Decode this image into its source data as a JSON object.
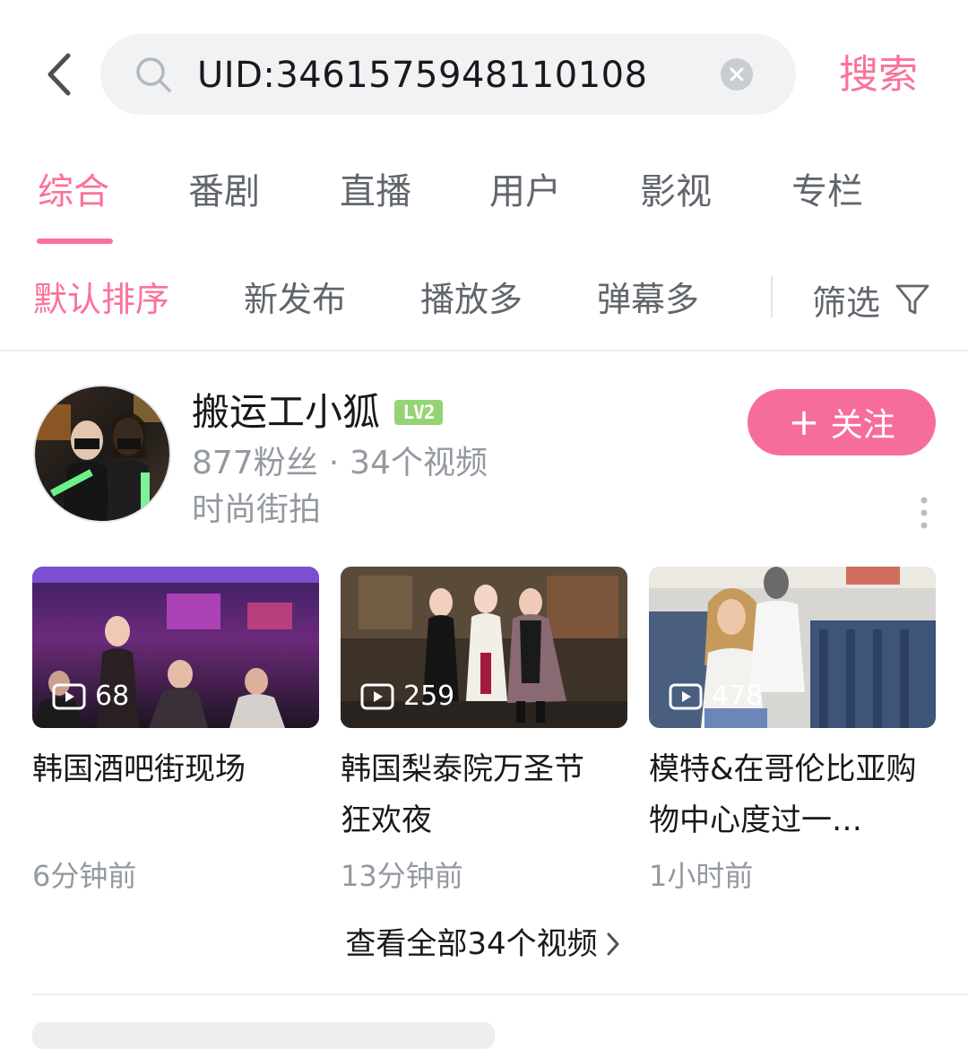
{
  "search": {
    "query": "UID:3461575948110108",
    "submit_label": "搜索"
  },
  "tabs": [
    {
      "label": "综合",
      "active": true
    },
    {
      "label": "番剧"
    },
    {
      "label": "直播"
    },
    {
      "label": "用户"
    },
    {
      "label": "影视"
    },
    {
      "label": "专栏"
    }
  ],
  "sort": {
    "options": [
      {
        "label": "默认排序",
        "active": true
      },
      {
        "label": "新发布"
      },
      {
        "label": "播放多"
      },
      {
        "label": "弹幕多"
      }
    ],
    "filter_label": "筛选"
  },
  "user": {
    "name": "搬运工小狐",
    "level": "LV2",
    "followers": "877粉丝",
    "separator": "·",
    "videos": "34个视频",
    "signature": "时尚街拍",
    "follow_plus": "+",
    "follow_label": "关注"
  },
  "videos": [
    {
      "plays": "68",
      "title": "韩国酒吧街现场",
      "time": "6分钟前"
    },
    {
      "plays": "259",
      "title": "韩国梨泰院万圣节狂欢夜",
      "time": "13分钟前"
    },
    {
      "plays": "478",
      "title": "模特&在哥伦比亚购物中心度过一…",
      "time": "1小时前"
    }
  ],
  "view_all_label": "查看全部34个视频",
  "colors": {
    "accent": "#fb7299",
    "follow_button": "#f76d99",
    "muted_text": "#9499a0",
    "level_badge": "#95d475"
  },
  "icons": {
    "back": "chevron-left-icon",
    "search": "search-icon",
    "clear": "clear-icon",
    "filter": "funnel-icon",
    "more": "more-vertical-icon",
    "play": "play-icon",
    "view_all": "chevron-right-icon"
  }
}
